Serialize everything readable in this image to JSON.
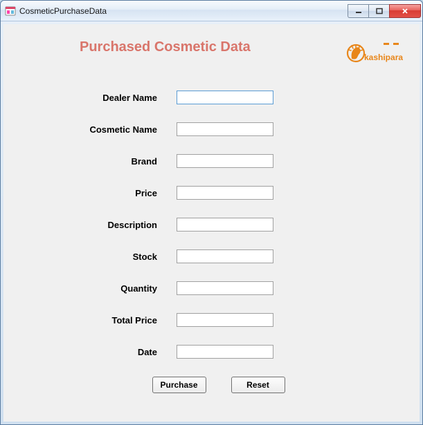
{
  "window": {
    "title": "CosmeticPurchaseData"
  },
  "header": {
    "title": "Purchased Cosmetic Data",
    "logo_text": "kashipara"
  },
  "form": {
    "fields": [
      {
        "label": "Dealer Name",
        "value": ""
      },
      {
        "label": "Cosmetic Name",
        "value": ""
      },
      {
        "label": "Brand",
        "value": ""
      },
      {
        "label": "Price",
        "value": ""
      },
      {
        "label": "Description",
        "value": ""
      },
      {
        "label": "Stock",
        "value": ""
      },
      {
        "label": "Quantity",
        "value": ""
      },
      {
        "label": "Total Price",
        "value": ""
      },
      {
        "label": "Date",
        "value": ""
      }
    ]
  },
  "buttons": {
    "purchase": "Purchase",
    "reset": "Reset"
  }
}
